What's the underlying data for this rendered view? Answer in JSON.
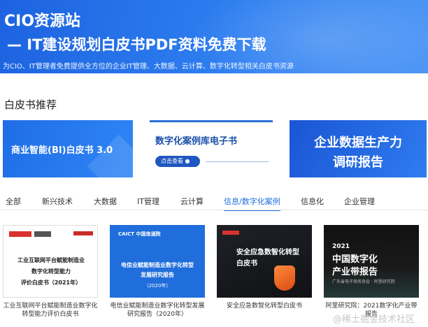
{
  "hero": {
    "title": "CIO资源站",
    "subtitle": "— IT建设规划白皮书PDF资料免费下载",
    "description": "为CIO、IT管理者免费提供全方位的企业IT管理、大数据、云计算、数字化转型相关白皮书资源"
  },
  "section": {
    "title": "白皮书推荐"
  },
  "banners": {
    "bi": "商业智能(BI)白皮书 3.0",
    "cases": {
      "title": "数字化案例库电子书",
      "button": "点击查看 ●"
    },
    "survey": {
      "line1": "企业数据生产力",
      "line2": "调研报告"
    }
  },
  "tabs": [
    {
      "label": "全部"
    },
    {
      "label": "新兴技术"
    },
    {
      "label": "大数据"
    },
    {
      "label": "IT管理"
    },
    {
      "label": "云计算"
    },
    {
      "label": "信息/数字化案例",
      "active": true
    },
    {
      "label": "信息化"
    },
    {
      "label": "企业管理"
    }
  ],
  "cards": [
    {
      "cover": {
        "line1": "工业互联网平台赋能制造业",
        "line2": "数字化转型能力",
        "line3": "评价白皮书（2021年）"
      },
      "caption": "工业互联网平台赋能制造业数字化转型能力评价白皮书"
    },
    {
      "cover": {
        "logo": "CAICT 中国信通院",
        "line1": "电信业赋能制造业数字化转型",
        "line2": "发展研究报告",
        "line3": "（2020年）"
      },
      "caption": "电信业赋能制造业数字化转型发展研究报告（2020年）"
    },
    {
      "cover": {
        "line1": "安全应急数智化转型",
        "line2": "白皮书"
      },
      "caption": "安全应急数智化转型白皮书"
    },
    {
      "cover": {
        "year": "2021",
        "line1": "中国数字化",
        "line2": "产业带报告",
        "sub": "广东省电子商务协会 · 阿里研究院"
      },
      "caption": "阿里研究院：2021数字化产业带报告"
    }
  ],
  "watermark": "@稀土掘金技术社区",
  "colors": {
    "primary": "#1e6fe0",
    "hero": "#2f7ff0"
  }
}
